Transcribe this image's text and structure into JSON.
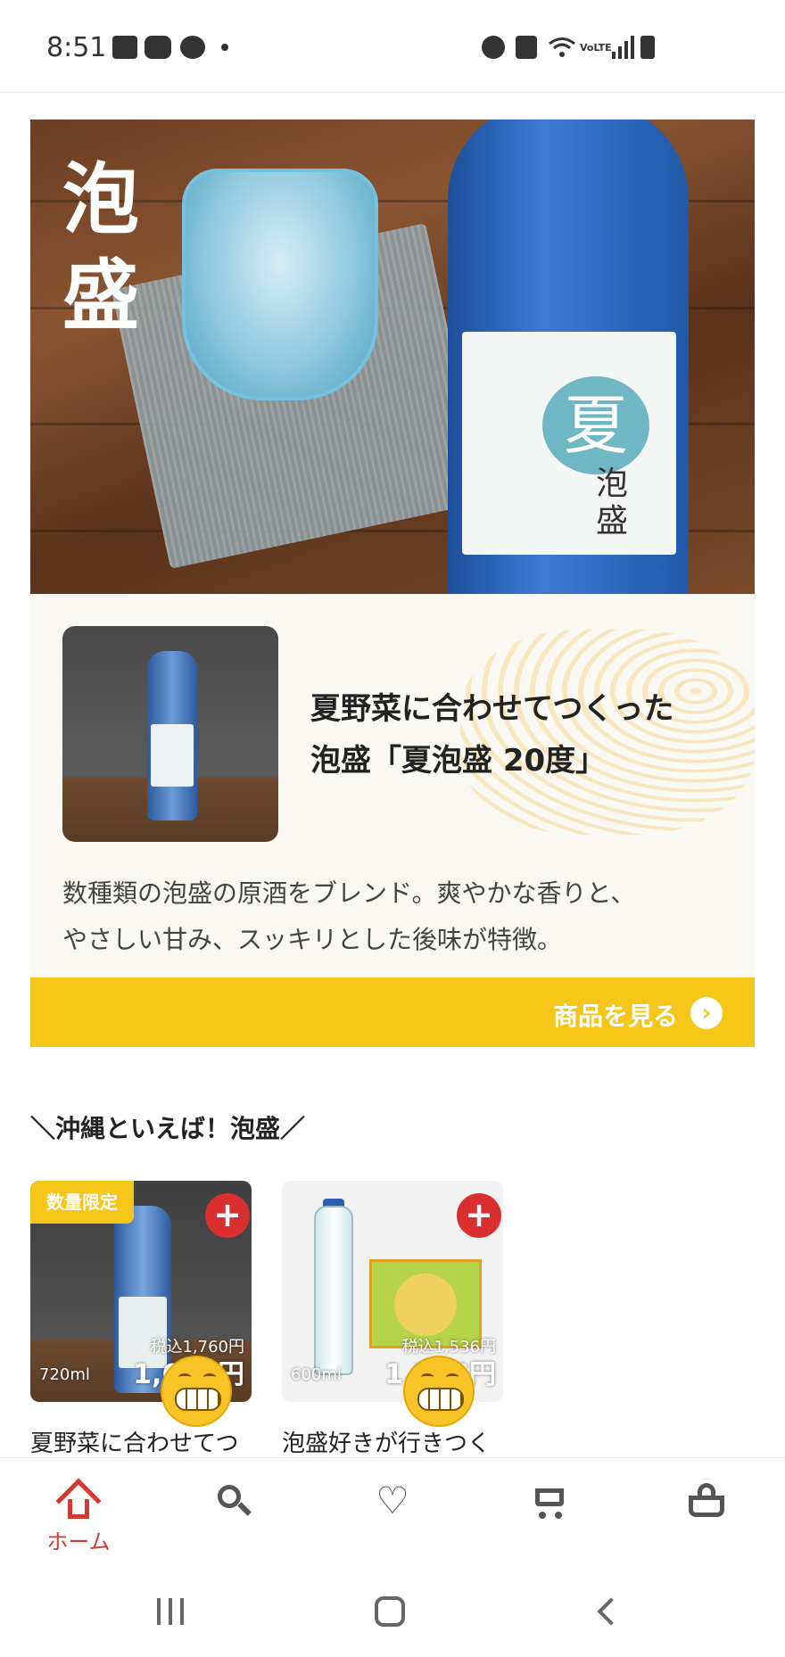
{
  "status_bar": {
    "time": "8:51",
    "left_icons": [
      "gallery-icon",
      "youtube-icon",
      "accessibility-icon",
      "dot-icon"
    ],
    "right_icons": [
      "alarm-icon",
      "mute-icon",
      "wifi-icon",
      "volte-icon",
      "signal-icon",
      "battery-icon"
    ],
    "volte_label": "VoLTE"
  },
  "banner": {
    "hero_title": "泡盛",
    "bottle_label_big": "夏",
    "bottle_label_small": "泡盛",
    "headline_line1": "夏野菜に合わせてつくった",
    "headline_line2": "泡盛「夏泡盛 20度」",
    "description_line1": "数種類の泡盛の原酒をブレンド。爽やかな香りと、",
    "description_line2": "やさしい甘み、スッキリとした後味が特徴。",
    "cta_label": "商品を見る",
    "cta_arrow": "›",
    "accent_color": "#f5c518"
  },
  "section": {
    "title": "＼沖縄といえば！泡盛／"
  },
  "products": [
    {
      "badge": "数量限定",
      "add_label": "+",
      "volume": "720ml",
      "price_tax": "税込1,760円",
      "price_main": "1,600円",
      "name": "夏野菜に合わせてつ"
    },
    {
      "badge": "",
      "add_label": "+",
      "volume": "600ml",
      "price_tax": "税込1,536円",
      "price_main": "1,396円",
      "name": "泡盛好きが行きつく"
    }
  ],
  "bottom_nav": {
    "items": [
      {
        "icon": "home-icon",
        "label": "ホーム",
        "active": true
      },
      {
        "icon": "search-icon",
        "label": ""
      },
      {
        "icon": "heart-icon",
        "label": ""
      },
      {
        "icon": "cart-icon",
        "label": ""
      },
      {
        "icon": "basket-icon",
        "label": ""
      }
    ],
    "active_color": "#d23a2f",
    "heart_glyph": "♡"
  },
  "system_nav": {
    "icons": [
      "recent-apps-icon",
      "home-button-icon",
      "back-icon"
    ]
  }
}
